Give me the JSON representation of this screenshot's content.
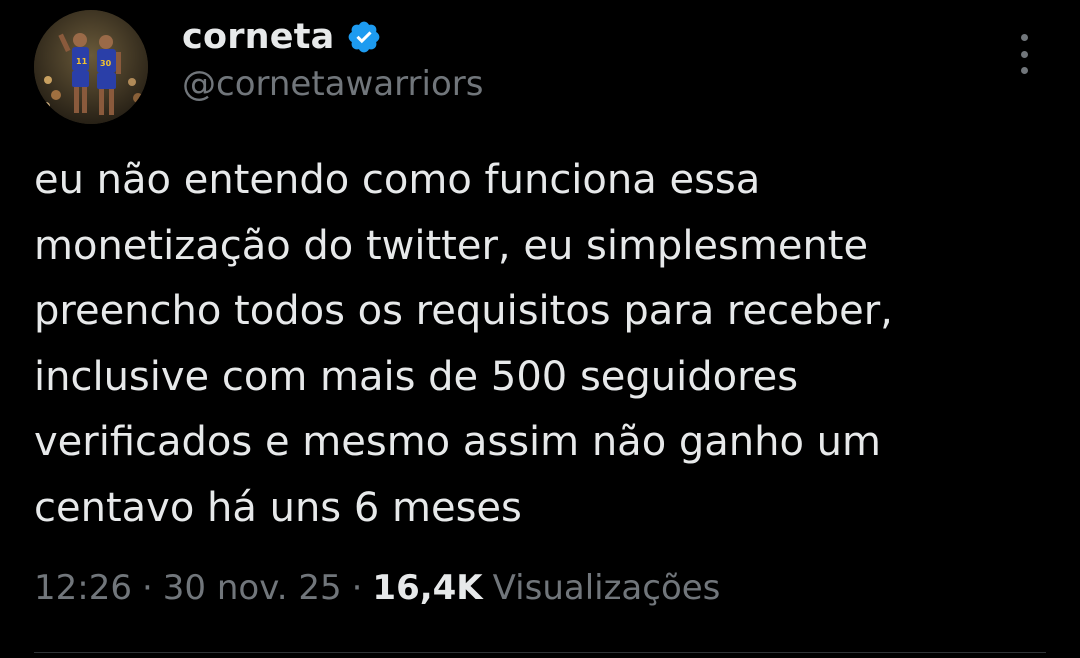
{
  "author": {
    "display_name": "corneta",
    "handle": "@cornetawarriors",
    "verified_icon": "verified-badge-icon",
    "verified_color": "#1d9bf0"
  },
  "tweet": {
    "text": "eu não entendo como funciona essa\nmonetização do twitter, eu simplesmente\npreencho todos os requisitos para receber,\ninclusive com mais de 500 seguidores\nverificados e mesmo assim não ganho um\ncentavo há uns 6 meses"
  },
  "meta": {
    "time": "12:26",
    "separator": "·",
    "date": "30 nov. 25",
    "views_count": "16,4K",
    "views_label": "Visualizações"
  },
  "colors": {
    "background": "#000000",
    "primary_text": "#e7e9ea",
    "secondary_text": "#71767b"
  }
}
